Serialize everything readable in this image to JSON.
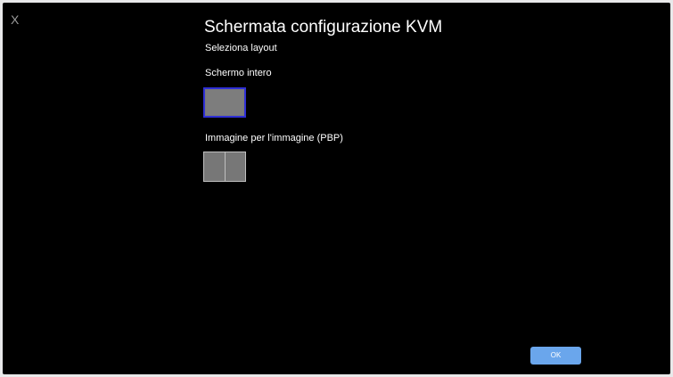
{
  "window": {
    "close_label": "X",
    "title": "Schermata configurazione KVM"
  },
  "layout_section": {
    "heading": "Seleziona layout",
    "options": [
      {
        "label": "Schermo intero",
        "selected": true
      },
      {
        "label": "Immagine per l'immagine (PBP)",
        "selected": false
      }
    ]
  },
  "footer": {
    "ok_label": "OK"
  },
  "colors": {
    "background": "#000000",
    "selection_border": "#2f2fd6",
    "ok_button": "#6aa6ec"
  }
}
